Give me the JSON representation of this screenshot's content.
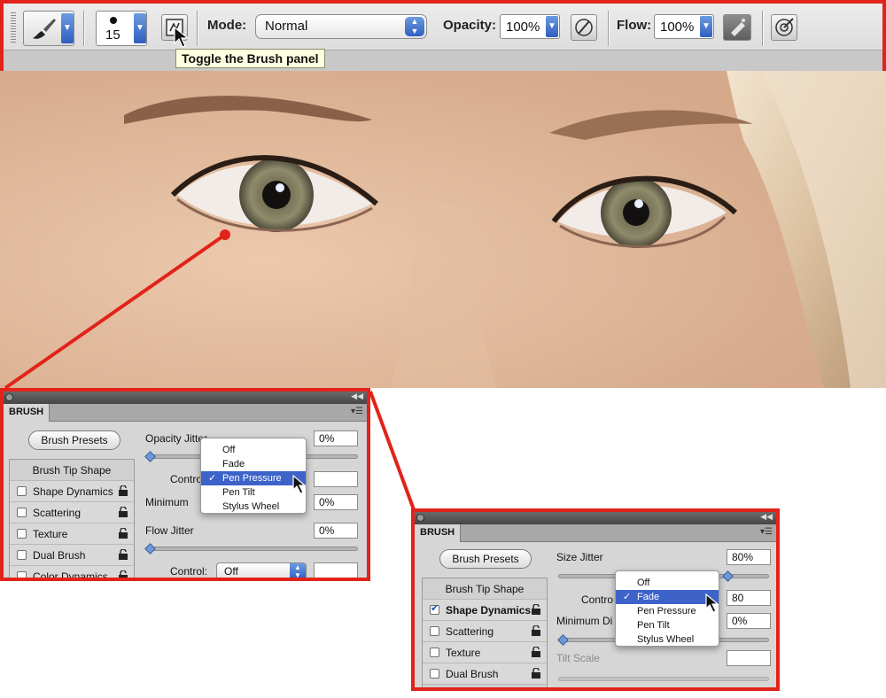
{
  "colors": {
    "callout": "#e2231a",
    "menu_highlight": "#3d63c9",
    "tooltip_bg": "#ffffe1"
  },
  "toolbar": {
    "brush_icon": "brush-icon",
    "brush_size": "15",
    "toggle_icon": "brush-panel-toggle-icon",
    "mode_label": "Mode:",
    "mode_value": "Normal",
    "opacity_label": "Opacity:",
    "opacity_value": "100%",
    "flow_label": "Flow:",
    "flow_value": "100%",
    "tooltip": "Toggle the Brush panel"
  },
  "panel_left": {
    "tab": "BRUSH",
    "presets_button": "Brush Presets",
    "list": {
      "header": "Brush Tip Shape",
      "items": [
        {
          "label": "Shape Dynamics",
          "checked": false
        },
        {
          "label": "Scattering",
          "checked": false
        },
        {
          "label": "Texture",
          "checked": false
        },
        {
          "label": "Dual Brush",
          "checked": false
        },
        {
          "label": "Color Dynamics",
          "checked": false
        }
      ]
    },
    "opacity_jitter_label": "Opacity Jitter",
    "opacity_jitter_value": "0%",
    "control_label": "Control",
    "minimum_label": "Minimum",
    "minimum_value": "0%",
    "flow_jitter_label": "Flow Jitter",
    "flow_jitter_value": "0%",
    "control2_label": "Control:",
    "control2_value": "Off",
    "dropdown": {
      "items": [
        "Off",
        "Fade",
        "Pen Pressure",
        "Pen Tilt",
        "Stylus Wheel"
      ],
      "selected": "Pen Pressure",
      "check": "✓"
    }
  },
  "panel_right": {
    "tab": "BRUSH",
    "presets_button": "Brush Presets",
    "list": {
      "header": "Brush Tip Shape",
      "items": [
        {
          "label": "Shape Dynamics",
          "checked": true
        },
        {
          "label": "Scattering",
          "checked": false
        },
        {
          "label": "Texture",
          "checked": false
        },
        {
          "label": "Dual Brush",
          "checked": false
        }
      ]
    },
    "size_jitter_label": "Size Jitter",
    "size_jitter_value": "80%",
    "control_label": "Contro",
    "control_number": "80",
    "minimum_label": "Minimum Di",
    "minimum_value": "0%",
    "tilt_label": "Tilt Scale",
    "dropdown": {
      "items": [
        "Off",
        "Fade",
        "Pen Pressure",
        "Pen Tilt",
        "Stylus Wheel"
      ],
      "selected": "Fade",
      "check": "✓"
    }
  }
}
